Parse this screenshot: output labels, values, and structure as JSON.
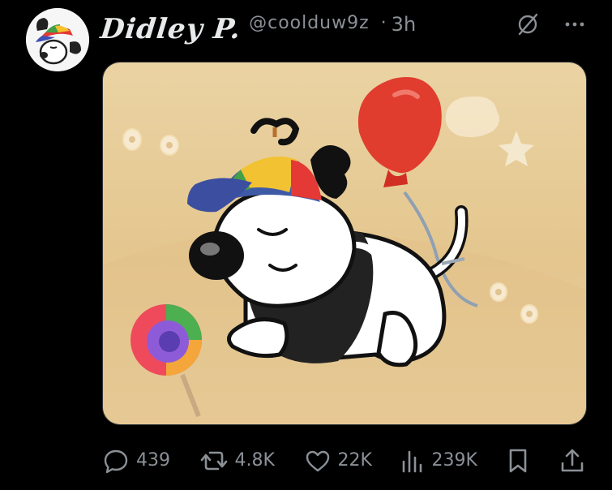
{
  "author": {
    "display_name": "Didley P.",
    "handle": "@coolduw9z",
    "separator": "·",
    "time_ago": "3h"
  },
  "top_actions": {
    "grok_icon": "slash-circle-icon",
    "more_icon": "more-horizontal-icon"
  },
  "media": {
    "type": "illustration"
  },
  "engagement": {
    "replies": "439",
    "reposts": "4.8K",
    "likes": "22K",
    "views": "239K"
  },
  "colors": {
    "background": "#000000",
    "text_primary": "#e7e9ea",
    "text_secondary": "#8b9096",
    "image_background": "#e6c88f"
  }
}
